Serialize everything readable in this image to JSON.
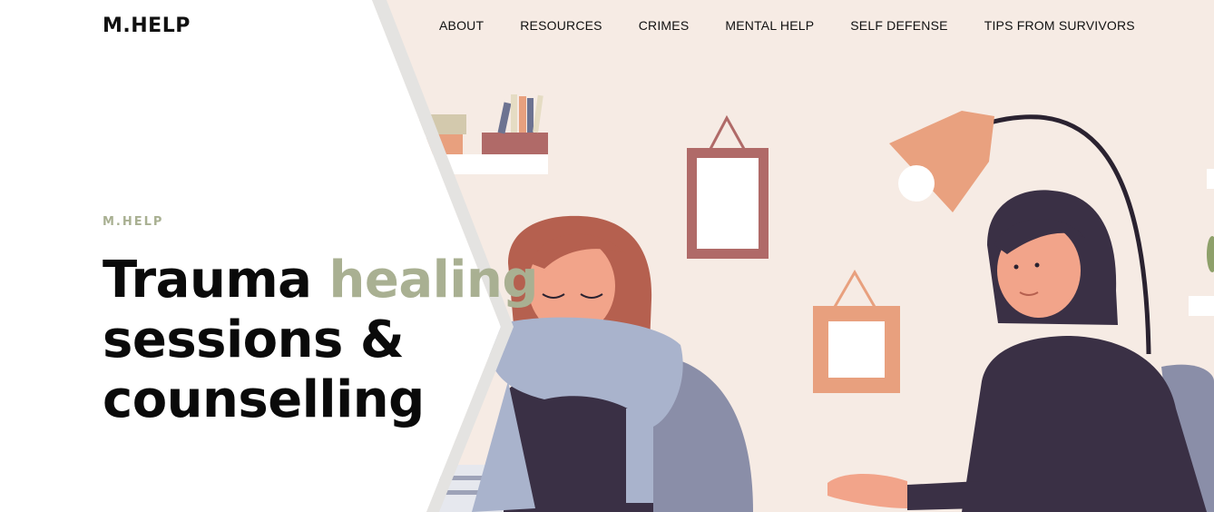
{
  "brand": {
    "logo_text": "M.HELP"
  },
  "nav": {
    "items": [
      {
        "label": "ABOUT"
      },
      {
        "label": "RESOURCES"
      },
      {
        "label": "CRIMES"
      },
      {
        "label": "MENTAL HELP"
      },
      {
        "label": "SELF DEFENSE"
      },
      {
        "label": "TIPS FROM SURVIVORS"
      }
    ]
  },
  "hero": {
    "eyebrow": "M.HELP",
    "headline_word1": "Trauma",
    "headline_accent": "healing",
    "headline_line2": "sessions &",
    "headline_line3": "counselling"
  },
  "colors": {
    "accent": "#a9b092",
    "text": "#0a0a0a",
    "wall": "#f6ebe4",
    "coral": "#e8a07e",
    "plum": "#3a3045"
  },
  "illustration": {
    "description_icons": [
      "two-women-therapy-illustration",
      "floor-lamp-icon",
      "bookshelf-icon",
      "picture-frame-icon"
    ]
  }
}
